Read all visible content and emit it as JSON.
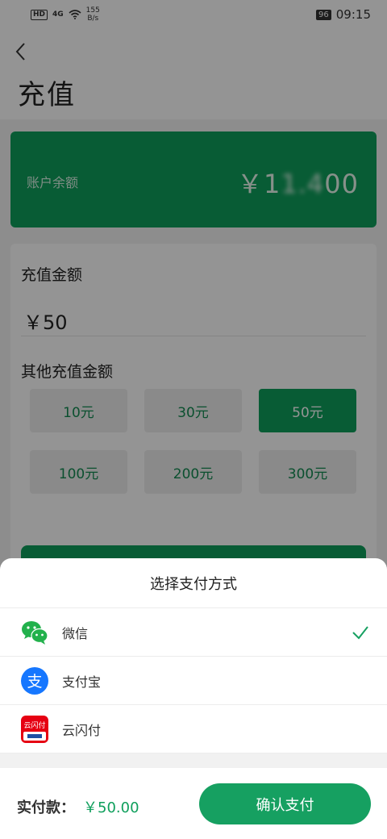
{
  "status_bar": {
    "hd": "HD",
    "signal": "4G",
    "speed_value": "155",
    "speed_unit": "B/s",
    "battery": "96",
    "time": "09:15"
  },
  "header": {
    "back_glyph": "‹",
    "title": "充值"
  },
  "balance": {
    "label": "账户余额",
    "value_prefix": "￥1",
    "value_obscured": "1.4",
    "value_suffix": "00"
  },
  "amount": {
    "label": "充值金额",
    "value": "￥50",
    "other_label": "其他充值金额",
    "options": [
      "10元",
      "30元",
      "50元",
      "100元",
      "200元",
      "300元"
    ],
    "selected_index": 2
  },
  "payment_sheet": {
    "title": "选择支付方式",
    "methods": [
      {
        "name": "微信",
        "icon": "wechat-icon",
        "selected": true
      },
      {
        "name": "支付宝",
        "icon": "alipay-icon",
        "selected": false
      },
      {
        "name": "云闪付",
        "icon": "unionpay-icon",
        "selected": false
      }
    ],
    "unionpay_icon_text": "云闪付",
    "alipay_icon_text": "支"
  },
  "footer": {
    "label": "实付款：",
    "amount": "￥50.00",
    "confirm_label": "确认支付"
  },
  "colors": {
    "accent": "#0f9f5c",
    "button": "#16a061",
    "alipay": "#1677ff",
    "unionpay": "#e60012",
    "wechat": "#22b14c"
  }
}
